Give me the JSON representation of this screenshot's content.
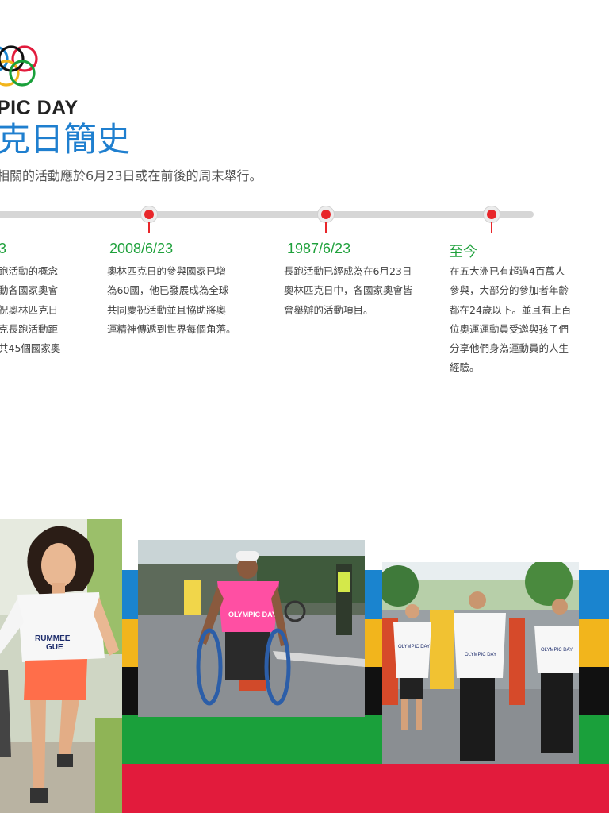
{
  "header": {
    "title_en": "PIC DAY",
    "title_zh": "克日簡史",
    "intro": "相關的活動應於6月23日或在前後的周末舉行。"
  },
  "timeline": [
    {
      "date": "3",
      "lines": [
        "跑活動的概念",
        "動各國家奧會",
        "祝奧林匹克日",
        "克長跑活動距",
        "共45個國家奧"
      ]
    },
    {
      "date": "2008/6/23",
      "lines": [
        "奧林匹克日的參與國家已增",
        "為60國，他已發展成為全球",
        "共同慶祝活動並且協助將奧",
        "運精神傳遞到世界每個角落。"
      ]
    },
    {
      "date": "1987/6/23",
      "lines": [
        "長跑活動已經成為在6月23日",
        "奧林匹克日中，各國家奧會皆",
        "會舉辦的活動項目。"
      ]
    },
    {
      "date": "至今",
      "lines": [
        "在五大洲已有超過4百萬人",
        "參與，大部分的參加者年齡",
        "都在24歲以下。並且有上百",
        "位奧運運動員受邀與孩子們",
        "分享他們身為運動員的人生",
        "經驗。"
      ]
    }
  ],
  "photos": {
    "girl_shirt_text": "RUMMEE",
    "girl_shirt_text2": "GUE",
    "wheelchair_shirt_text": "OLYMPIC DAY",
    "runners_shirt_text": "OLYMPIC DAY"
  },
  "colors": {
    "blue": "#1a84cf",
    "yellow": "#f2b51c",
    "black": "#111111",
    "green": "#1aa03b",
    "red": "#e21b3c",
    "date_green": "#1fa13c",
    "title_blue": "#1f7fcf",
    "pin_red": "#e8262a"
  }
}
